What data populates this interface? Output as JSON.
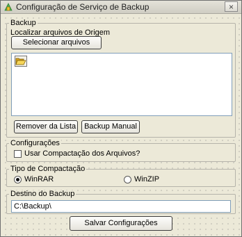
{
  "window": {
    "title": "Configuração de Serviço de Backup",
    "close_glyph": "×",
    "icon": "app-icon"
  },
  "backup": {
    "legend": "Backup",
    "origin_label": "Localizar arquivos de Origem",
    "select_button": "Selecionar arquivos",
    "list_icon": "folder-open-icon",
    "remove_button": "Remover da Lista",
    "manual_button": "Backup Manual"
  },
  "settings": {
    "legend": "Configurações",
    "compress_label": "Usar Compactação dos Arquivos?",
    "compress_checked": false
  },
  "compression": {
    "legend": "Tipo de Compactação",
    "options": [
      {
        "label": "WinRAR",
        "selected": true
      },
      {
        "label": "WinZIP",
        "selected": false
      }
    ]
  },
  "destination": {
    "legend": "Destino do Backup",
    "value": "C:\\Backup\\"
  },
  "save_button": "Salvar Configurações"
}
